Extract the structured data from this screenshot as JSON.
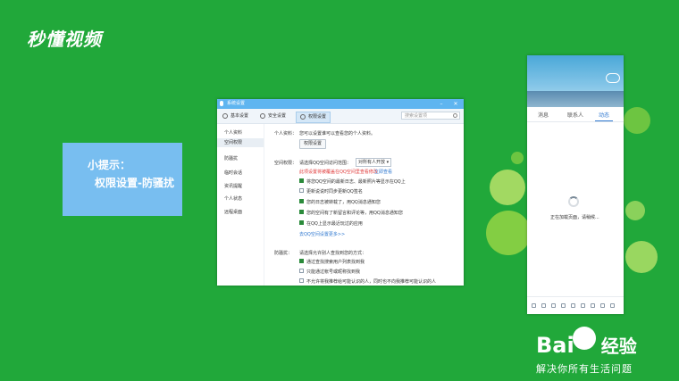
{
  "logo": {
    "text": "秒懂视频"
  },
  "tip": {
    "title": "小提示：",
    "body": "权限设置-防骚扰"
  },
  "window": {
    "title": "系统设置",
    "tabs": [
      {
        "label": "基本设置"
      },
      {
        "label": "安全设置"
      },
      {
        "label": "权限设置"
      }
    ],
    "search_placeholder": "搜索设置项",
    "sidebar": [
      "个人资料",
      "空间权限",
      "防骚扰",
      "临时会话",
      "资讯提醒",
      "个人状态",
      "远程桌面"
    ],
    "personal": {
      "label": "个人资料：",
      "desc": "您可以设置谁可以查看您的个人资料。",
      "button": "权限设置"
    },
    "space": {
      "label": "空间权限：",
      "prompt": "请选择QQ空间访问范围：",
      "select_value": "对所有人开放",
      "warning": "此项设置将被覆盖在QQ空间里查看修改",
      "warning_link": "立即查看",
      "options": [
        {
          "text": "将您QQ空间的最新日志、最新照片等显示在QQ上",
          "checked": true
        },
        {
          "text": "更新说说时同步更新QQ签名",
          "checked": false
        },
        {
          "text": "您的日志被转载了，用QQ消息通知您",
          "checked": true
        },
        {
          "text": "您的空间有了新留言和评论等，用QQ消息通知您",
          "checked": true
        },
        {
          "text": "在QQ上显示最近玩过的应用",
          "checked": true
        }
      ],
      "more_link": "去QQ空间设置更多>>"
    },
    "anti": {
      "label": "防骚扰：",
      "prompt": "请选择允许别人查找到您的方式：",
      "options": [
        {
          "text": "通过查找搜索用户列表找到我",
          "checked": true
        },
        {
          "text": "只能通过帐号或昵称找到我",
          "checked": false
        },
        {
          "text": "不允许将我推荐给可能认识的人，同时也不向我推荐可能认识的人",
          "checked": false
        }
      ]
    }
  },
  "phone": {
    "tabs": [
      "消息",
      "联系人",
      "动态"
    ],
    "active_tab": 2,
    "loading": "正在加载页面，请稍候..."
  },
  "baidu": {
    "brand": "Bai",
    "brand2": "经验",
    "slogan": "解决你所有生活问题"
  }
}
